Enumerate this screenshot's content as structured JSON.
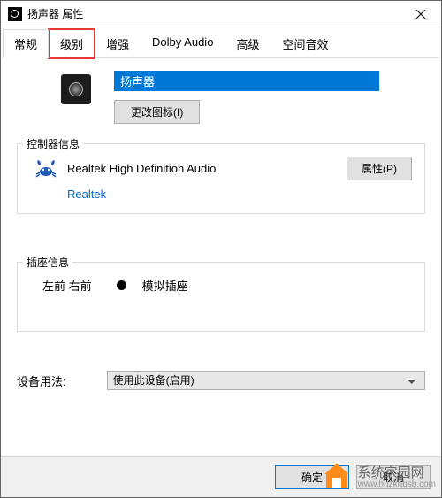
{
  "window": {
    "title": "扬声器 属性"
  },
  "tabs": {
    "items": [
      {
        "label": "常规"
      },
      {
        "label": "级别"
      },
      {
        "label": "增强"
      },
      {
        "label": "Dolby Audio"
      },
      {
        "label": "高级"
      },
      {
        "label": "空间音效"
      }
    ]
  },
  "general": {
    "name_value": "扬声器",
    "change_icon_label": "更改图标(I)"
  },
  "controller": {
    "legend": "控制器信息",
    "name": "Realtek High Definition Audio",
    "vendor": "Realtek",
    "properties_label": "属性(P)"
  },
  "jack": {
    "legend": "插座信息",
    "position": "左前 右前",
    "type": "模拟插座"
  },
  "usage": {
    "label": "设备用法:",
    "selected": "使用此设备(启用)"
  },
  "footer": {
    "ok": "确定",
    "cancel": "取消"
  },
  "watermark": {
    "title": "系统家园网",
    "url": "www.hnzkhbsb.com"
  }
}
